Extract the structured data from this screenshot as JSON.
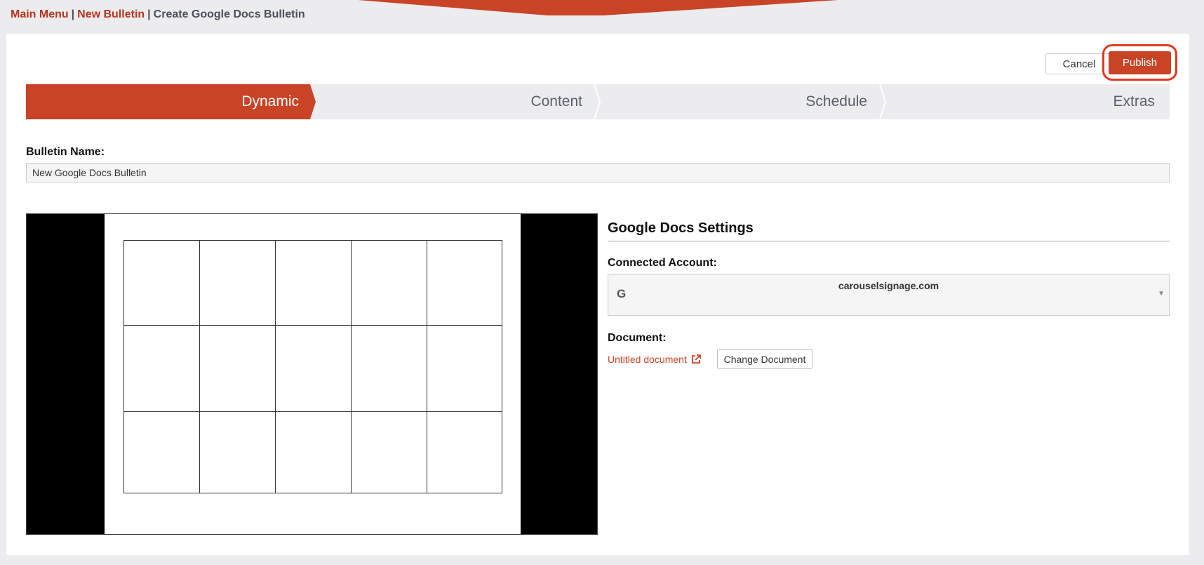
{
  "breadcrumb": {
    "main_menu": "Main Menu",
    "new_bulletin": "New Bulletin",
    "current": "Create Google Docs Bulletin",
    "separator": "|"
  },
  "toolbar": {
    "cancel_label": "Cancel",
    "publish_label": "Publish"
  },
  "steps": [
    {
      "label": "Dynamic",
      "active": true
    },
    {
      "label": "Content",
      "active": false
    },
    {
      "label": "Schedule",
      "active": false
    },
    {
      "label": "Extras",
      "active": false
    }
  ],
  "form": {
    "bulletin_name_label": "Bulletin Name:",
    "bulletin_name_value": "New Google Docs Bulletin"
  },
  "settings": {
    "title": "Google Docs Settings",
    "connected_account_label": "Connected Account:",
    "account_value": "carouselsignage.com",
    "account_icon": "google-icon",
    "document_label": "Document:",
    "document_name": "Untitled document",
    "document_link_icon": "external-link-icon",
    "change_document_label": "Change Document"
  },
  "preview": {
    "grid_rows": 3,
    "grid_cols": 5
  },
  "colors": {
    "accent": "#c94326",
    "link": "#b6341d",
    "step_inactive_bg": "#ececee",
    "step_inactive_text": "#5a5f6c",
    "publish_ring": "#e03a22"
  }
}
